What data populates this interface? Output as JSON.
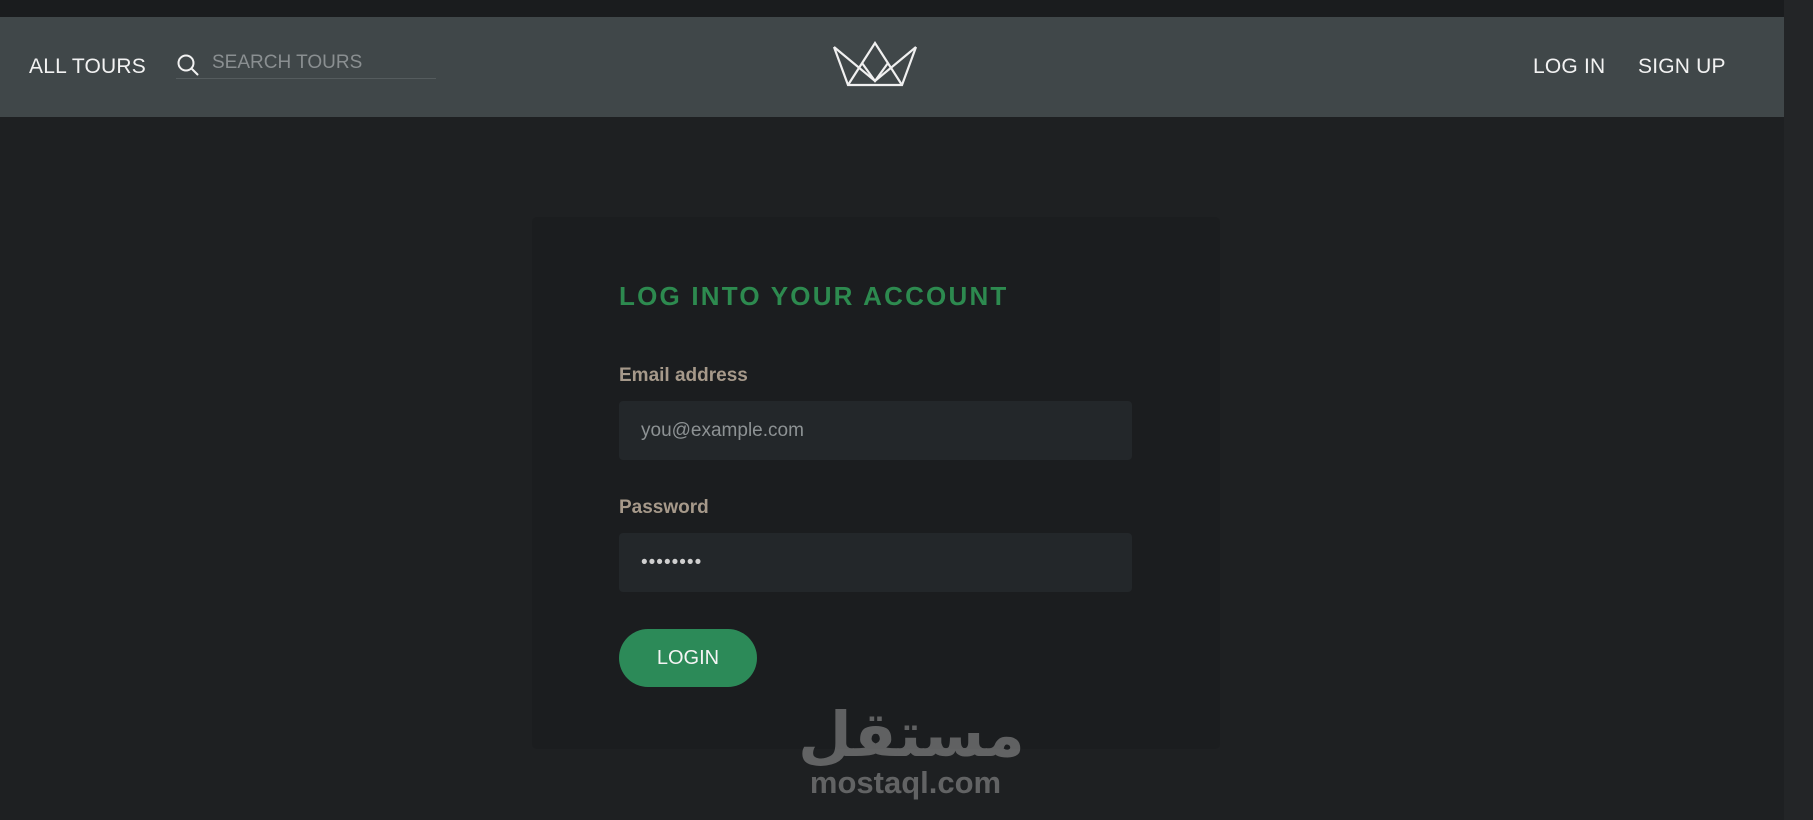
{
  "header": {
    "all_tours": "ALL TOURS",
    "search_placeholder": "SEARCH TOURS",
    "search_icon": "search-icon",
    "logo_icon": "crown-logo-icon",
    "log_in": "LOG IN",
    "sign_up": "SIGN UP"
  },
  "login_form": {
    "title": "LOG INTO YOUR ACCOUNT",
    "email_label": "Email address",
    "email_placeholder": "you@example.com",
    "password_label": "Password",
    "password_value": "••••••••",
    "submit_label": "LOGIN"
  },
  "watermark": {
    "arabic": "مستقل",
    "latin": "mostaql.com"
  },
  "colors": {
    "page_background": "#1e2022",
    "header_background": "#404749",
    "card_background": "#1b1d1f",
    "accent_green": "#2d8a4f",
    "button_green": "#2c8a58",
    "label_color": "#a6998a"
  }
}
